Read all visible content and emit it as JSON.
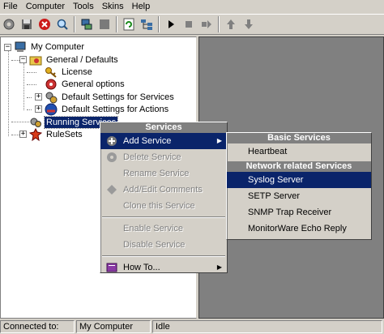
{
  "menubar": {
    "items": [
      "File",
      "Computer",
      "Tools",
      "Skins",
      "Help"
    ]
  },
  "toolbar": {
    "icons": [
      "settings-icon",
      "save-icon",
      "stop-red-icon",
      "search-icon",
      "network-icon",
      "square-icon",
      "refresh-icon",
      "tree-icon",
      "play-icon",
      "stop-icon",
      "forward-icon",
      "up-arrow-icon",
      "down-arrow-icon"
    ]
  },
  "tree": {
    "root": "My Computer",
    "general_defaults": "General / Defaults",
    "license": "License",
    "general_options": "General options",
    "default_services": "Default Settings for Services",
    "default_actions": "Default Settings for Actions",
    "running_services": "Running Services",
    "rulesets": "RuleSets"
  },
  "context_menu": {
    "header": "Services",
    "add_service": "Add Service",
    "delete_service": "Delete Service",
    "rename_service": "Rename Service",
    "add_edit_comments": "Add/Edit Comments",
    "clone_service": "Clone this Service",
    "enable_service": "Enable Service",
    "disable_service": "Disable Service",
    "how_to": "How To..."
  },
  "submenu": {
    "basic_header": "Basic Services",
    "heartbeat": "Heartbeat",
    "network_header": "Network related Services",
    "syslog": "Syslog Server",
    "setp": "SETP Server",
    "snmp": "SNMP Trap Receiver",
    "echo": "MonitorWare Echo Reply"
  },
  "statusbar": {
    "connected_label": "Connected to:",
    "computer": "My Computer",
    "state": "Idle"
  },
  "colors": {
    "highlight": "#0a246a",
    "face": "#d4d0c8",
    "shadow": "#808080"
  }
}
